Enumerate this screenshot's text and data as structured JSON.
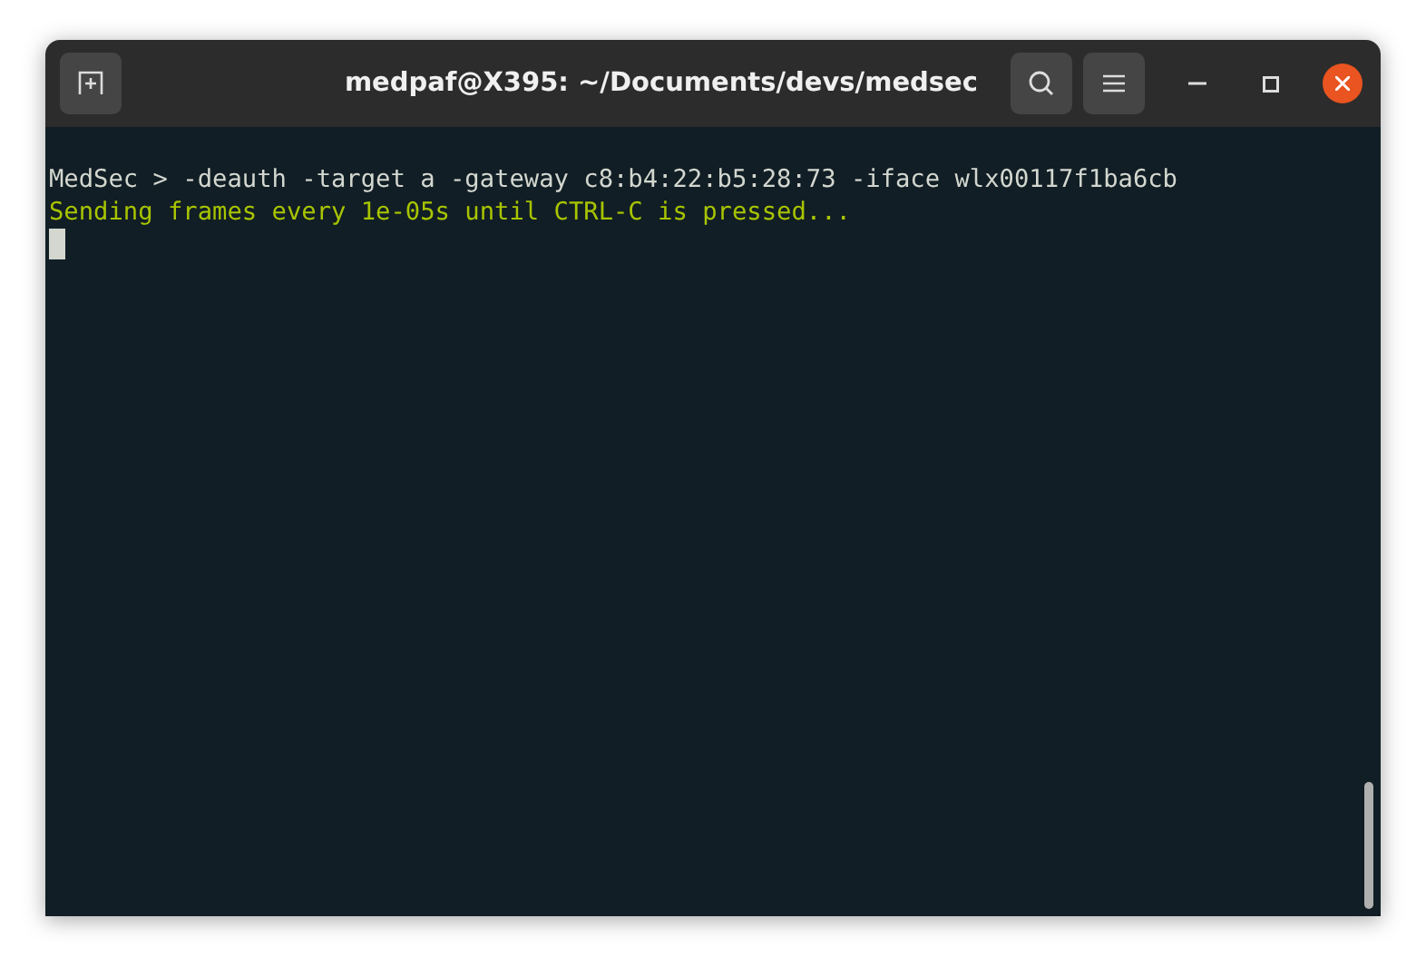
{
  "window": {
    "title": "medpaf@X395: ~/Documents/devs/medsec"
  },
  "terminal": {
    "lines": [
      {
        "text": "MedSec > -deauth -target a -gateway c8:b4:22:b5:28:73 -iface wlx00117f1ba6cb",
        "color": "#d3d7cf"
      },
      {
        "text": "Sending frames every 1e-05s until CTRL-C is pressed...",
        "color": "#a8c400"
      }
    ]
  }
}
